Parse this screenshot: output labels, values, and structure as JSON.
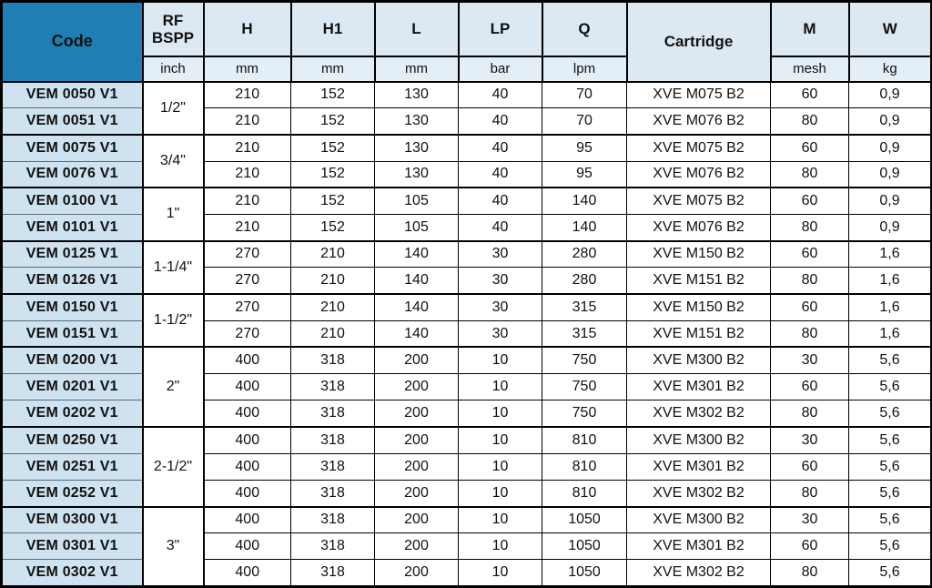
{
  "table": {
    "columns": [
      {
        "key": "code",
        "label": "Code",
        "unit": ""
      },
      {
        "key": "rf_bspp",
        "label": "RF\nBSPP",
        "unit": "inch"
      },
      {
        "key": "h",
        "label": "H",
        "unit": "mm"
      },
      {
        "key": "h1",
        "label": "H1",
        "unit": "mm"
      },
      {
        "key": "l",
        "label": "L",
        "unit": "mm"
      },
      {
        "key": "lp",
        "label": "LP",
        "unit": "bar"
      },
      {
        "key": "q",
        "label": "Q",
        "unit": "lpm"
      },
      {
        "key": "cartridge",
        "label": "Cartridge",
        "unit": ""
      },
      {
        "key": "m",
        "label": "M",
        "unit": "mesh"
      },
      {
        "key": "w",
        "label": "W",
        "unit": "kg"
      }
    ],
    "header": {
      "code_label": "Code",
      "rf_line1": "RF",
      "rf_line2": "BSPP",
      "h_label": "H",
      "h1_label": "H1",
      "l_label": "L",
      "lp_label": "LP",
      "q_label": "Q",
      "cartridge_label": "Cartridge",
      "m_label": "M",
      "w_label": "W",
      "unit_inch": "inch",
      "unit_mm_h": "mm",
      "unit_mm_h1": "mm",
      "unit_mm_l": "mm",
      "unit_bar": "bar",
      "unit_lpm": "lpm",
      "unit_mesh": "mesh",
      "unit_kg": "kg"
    },
    "groups": [
      {
        "size": "1/2\"",
        "rows": [
          {
            "code": "VEM 0050 V1",
            "h": "210",
            "h1": "152",
            "l": "130",
            "lp": "40",
            "q": "70",
            "cartridge": "XVE M075 B2",
            "m": "60",
            "w": "0,9"
          },
          {
            "code": "VEM 0051 V1",
            "h": "210",
            "h1": "152",
            "l": "130",
            "lp": "40",
            "q": "70",
            "cartridge": "XVE M076 B2",
            "m": "80",
            "w": "0,9"
          }
        ]
      },
      {
        "size": "3/4\"",
        "rows": [
          {
            "code": "VEM 0075 V1",
            "h": "210",
            "h1": "152",
            "l": "130",
            "lp": "40",
            "q": "95",
            "cartridge": "XVE M075 B2",
            "m": "60",
            "w": "0,9"
          },
          {
            "code": "VEM 0076 V1",
            "h": "210",
            "h1": "152",
            "l": "130",
            "lp": "40",
            "q": "95",
            "cartridge": "XVE M076 B2",
            "m": "80",
            "w": "0,9"
          }
        ]
      },
      {
        "size": "1\"",
        "rows": [
          {
            "code": "VEM 0100 V1",
            "h": "210",
            "h1": "152",
            "l": "105",
            "lp": "40",
            "q": "140",
            "cartridge": "XVE M075 B2",
            "m": "60",
            "w": "0,9"
          },
          {
            "code": "VEM 0101 V1",
            "h": "210",
            "h1": "152",
            "l": "105",
            "lp": "40",
            "q": "140",
            "cartridge": "XVE M076 B2",
            "m": "80",
            "w": "0,9"
          }
        ]
      },
      {
        "size": "1-1/4\"",
        "rows": [
          {
            "code": "VEM 0125 V1",
            "h": "270",
            "h1": "210",
            "l": "140",
            "lp": "30",
            "q": "280",
            "cartridge": "XVE M150 B2",
            "m": "60",
            "w": "1,6"
          },
          {
            "code": "VEM 0126 V1",
            "h": "270",
            "h1": "210",
            "l": "140",
            "lp": "30",
            "q": "280",
            "cartridge": "XVE M151 B2",
            "m": "80",
            "w": "1,6"
          }
        ]
      },
      {
        "size": "1-1/2\"",
        "rows": [
          {
            "code": "VEM 0150 V1",
            "h": "270",
            "h1": "210",
            "l": "140",
            "lp": "30",
            "q": "315",
            "cartridge": "XVE M150 B2",
            "m": "60",
            "w": "1,6"
          },
          {
            "code": "VEM 0151 V1",
            "h": "270",
            "h1": "210",
            "l": "140",
            "lp": "30",
            "q": "315",
            "cartridge": "XVE M151 B2",
            "m": "80",
            "w": "1,6"
          }
        ]
      },
      {
        "size": "2\"",
        "rows": [
          {
            "code": "VEM 0200 V1",
            "h": "400",
            "h1": "318",
            "l": "200",
            "lp": "10",
            "q": "750",
            "cartridge": "XVE M300 B2",
            "m": "30",
            "w": "5,6"
          },
          {
            "code": "VEM 0201 V1",
            "h": "400",
            "h1": "318",
            "l": "200",
            "lp": "10",
            "q": "750",
            "cartridge": "XVE M301 B2",
            "m": "60",
            "w": "5,6"
          },
          {
            "code": "VEM 0202 V1",
            "h": "400",
            "h1": "318",
            "l": "200",
            "lp": "10",
            "q": "750",
            "cartridge": "XVE M302 B2",
            "m": "80",
            "w": "5,6"
          }
        ]
      },
      {
        "size": "2-1/2\"",
        "rows": [
          {
            "code": "VEM 0250 V1",
            "h": "400",
            "h1": "318",
            "l": "200",
            "lp": "10",
            "q": "810",
            "cartridge": "XVE M300 B2",
            "m": "30",
            "w": "5,6"
          },
          {
            "code": "VEM 0251 V1",
            "h": "400",
            "h1": "318",
            "l": "200",
            "lp": "10",
            "q": "810",
            "cartridge": "XVE M301 B2",
            "m": "60",
            "w": "5,6"
          },
          {
            "code": "VEM 0252 V1",
            "h": "400",
            "h1": "318",
            "l": "200",
            "lp": "10",
            "q": "810",
            "cartridge": "XVE M302 B2",
            "m": "80",
            "w": "5,6"
          }
        ]
      },
      {
        "size": "3\"",
        "rows": [
          {
            "code": "VEM 0300 V1",
            "h": "400",
            "h1": "318",
            "l": "200",
            "lp": "10",
            "q": "1050",
            "cartridge": "XVE M300 B2",
            "m": "30",
            "w": "5,6"
          },
          {
            "code": "VEM 0301 V1",
            "h": "400",
            "h1": "318",
            "l": "200",
            "lp": "10",
            "q": "1050",
            "cartridge": "XVE M301 B2",
            "m": "60",
            "w": "5,6"
          },
          {
            "code": "VEM 0302 V1",
            "h": "400",
            "h1": "318",
            "l": "200",
            "lp": "10",
            "q": "1050",
            "cartridge": "XVE M302 B2",
            "m": "80",
            "w": "5,6"
          }
        ]
      }
    ]
  },
  "colors": {
    "code_header_bg": "#1f7fb5",
    "header_bg": "#dce9f2",
    "unit_bg": "#e4eef6",
    "code_cell_bg": "#cfe2f0",
    "border": "#000000"
  }
}
